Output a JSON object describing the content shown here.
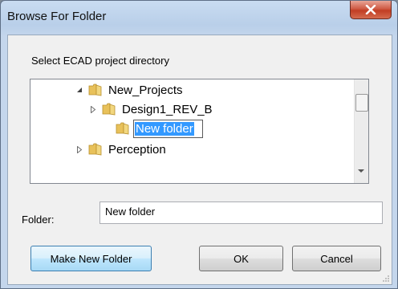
{
  "window": {
    "title": "Browse For Folder",
    "close_icon": "close-icon"
  },
  "dialog": {
    "prompt": "Select ECAD project directory",
    "tree": {
      "items": [
        {
          "label": "New_Projects",
          "state": "expanded",
          "icon": "folder-icon"
        },
        {
          "label": "Design1_REV_B",
          "state": "collapsed",
          "icon": "folder-icon"
        },
        {
          "label": "New folder",
          "state": "renaming",
          "icon": "folder-icon"
        },
        {
          "label": "Perception",
          "state": "collapsed",
          "icon": "folder-icon"
        }
      ]
    },
    "folder": {
      "label": "Folder:",
      "value": "New folder"
    },
    "buttons": {
      "make_new_folder": "Make New Folder",
      "ok": "OK",
      "cancel": "Cancel"
    }
  },
  "colors": {
    "selection": "#3399ff",
    "close_button": "#c13d23",
    "primary_border": "#3c7fb1"
  }
}
